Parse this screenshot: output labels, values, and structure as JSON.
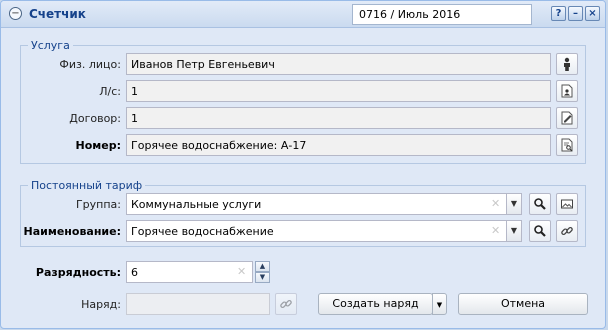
{
  "window": {
    "title": "Счетчик",
    "period": "0716 / Июль 2016",
    "help_label": "?",
    "minimize_label": "–",
    "close_label": "×"
  },
  "service": {
    "legend": "Услуга",
    "person_label": "Физ. лицо:",
    "person_value": "Иванов Петр Евгеньевич",
    "account_label": "Л/с:",
    "account_value": "1",
    "contract_label": "Договор:",
    "contract_value": "1",
    "number_label": "Номер:",
    "number_value": "Горячее водоснабжение: А-17"
  },
  "tariff": {
    "legend": "Постоянный тариф",
    "group_label": "Группа:",
    "group_value": "Коммунальные услуги",
    "name_label": "Наименование:",
    "name_value": "Горячее водоснабжение"
  },
  "bottom": {
    "digits_label": "Разрядность:",
    "digits_value": "6",
    "order_label": "Наряд:",
    "order_value": "",
    "create_order_label": "Создать наряд",
    "cancel_label": "Отмена"
  }
}
